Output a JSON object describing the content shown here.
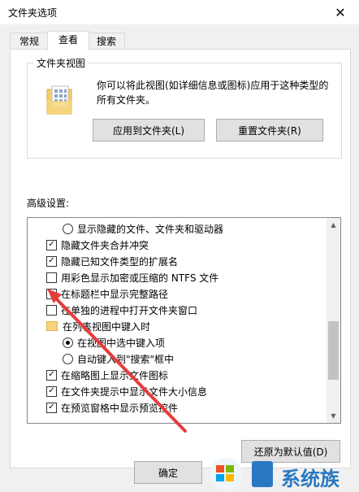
{
  "window": {
    "title": "文件夹选项",
    "close_glyph": "✕"
  },
  "tabs": [
    {
      "label": "常规",
      "active": false
    },
    {
      "label": "查看",
      "active": true
    },
    {
      "label": "搜索",
      "active": false
    }
  ],
  "folder_views": {
    "title": "文件夹视图",
    "description": "你可以将此视图(如详细信息或图标)应用于这种类型的所有文件夹。",
    "apply_button": "应用到文件夹(L)",
    "reset_button": "重置文件夹(R)"
  },
  "advanced": {
    "label": "高级设置:",
    "items": [
      {
        "type": "radio",
        "checked": false,
        "label": "显示隐藏的文件、文件夹和驱动器"
      },
      {
        "type": "checkbox",
        "checked": true,
        "label": "隐藏文件夹合并冲突"
      },
      {
        "type": "checkbox",
        "checked": true,
        "label": "隐藏已知文件类型的扩展名"
      },
      {
        "type": "checkbox",
        "checked": false,
        "label": "用彩色显示加密或压缩的 NTFS 文件"
      },
      {
        "type": "checkbox",
        "checked": false,
        "label": "在标题栏中显示完整路径"
      },
      {
        "type": "checkbox",
        "checked": false,
        "label": "在单独的进程中打开文件夹窗口"
      },
      {
        "type": "folder",
        "label": "在列表视图中键入时"
      },
      {
        "type": "radio",
        "checked": true,
        "label": "在视图中选中键入项"
      },
      {
        "type": "radio",
        "checked": false,
        "label": "自动键入到\"搜索\"框中"
      },
      {
        "type": "checkbox",
        "checked": true,
        "label": "在缩略图上显示文件图标"
      },
      {
        "type": "checkbox",
        "checked": true,
        "label": "在文件夹提示中显示文件大小信息"
      },
      {
        "type": "checkbox",
        "checked": true,
        "label": "在预览窗格中显示预览控件"
      }
    ],
    "check_glyph": "✓",
    "scroll_position": 0.75,
    "restore_button": "还原为默认值(D)"
  },
  "footer": {
    "ok_button": "确定"
  },
  "watermark": {
    "text": "系统族",
    "brand_color": "#2b78c2"
  },
  "annotation": {
    "color": "#e53d3d"
  }
}
